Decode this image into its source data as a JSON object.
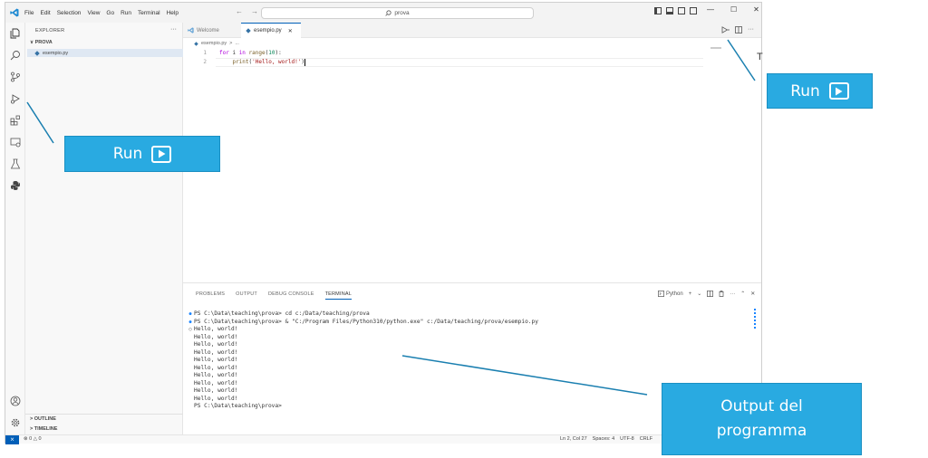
{
  "titlebar": {
    "menu": [
      "File",
      "Edit",
      "Selection",
      "View",
      "Go",
      "Run",
      "Terminal",
      "Help"
    ],
    "search_text": "prova",
    "back_glyph": "←",
    "forward_glyph": "→",
    "min_glyph": "—",
    "max_glyph": "☐",
    "close_glyph": "✕"
  },
  "sidebar": {
    "header": "EXPLORER",
    "folder": "PROVA",
    "file": "esempio.py",
    "outline": "OUTLINE",
    "timeline": "TIMELINE",
    "more_glyph": "···",
    "chevron_open": "∨",
    "chevron_closed": ">"
  },
  "editor": {
    "tabs": [
      {
        "label": "Welcome",
        "active": false
      },
      {
        "label": "esempio.py",
        "active": true
      }
    ],
    "tab_close_glyph": "✕",
    "breadcrumb": [
      "esempio.py",
      ">",
      "..."
    ],
    "lines": [
      {
        "num": "1",
        "kw": "for",
        "rest_a": " i ",
        "kw2": "in",
        "fn": " range",
        "num_lit": "10",
        "tail": "):"
      },
      {
        "num": "2",
        "indent": "    ",
        "fn": "print",
        "str": "'Hello, world!'",
        "tail": ")"
      }
    ]
  },
  "panel": {
    "tabs": [
      "PROBLEMS",
      "OUTPUT",
      "DEBUG CONSOLE",
      "TERMINAL"
    ],
    "active_tab": "TERMINAL",
    "terminal_profile": "Python",
    "terminal_lines": [
      {
        "dot": "●",
        "text": "PS C:\\Data\\teaching\\prova> cd c:/Data/teaching/prova"
      },
      {
        "dot": "●",
        "text": "PS C:\\Data\\teaching\\prova> & \"C:/Program Files/Python310/python.exe\" c:/Data/teaching/prova/esempio.py"
      },
      {
        "dot": "○",
        "text": "Hello, world!"
      },
      {
        "dot": "",
        "text": "Hello, world!"
      },
      {
        "dot": "",
        "text": "Hello, world!"
      },
      {
        "dot": "",
        "text": "Hello, world!"
      },
      {
        "dot": "",
        "text": "Hello, world!"
      },
      {
        "dot": "",
        "text": "Hello, world!"
      },
      {
        "dot": "",
        "text": "Hello, world!"
      },
      {
        "dot": "",
        "text": "Hello, world!"
      },
      {
        "dot": "",
        "text": "Hello, world!"
      },
      {
        "dot": "",
        "text": "Hello, world!"
      },
      {
        "dot": "",
        "text": "PS C:\\Data\\teaching\\prova>"
      }
    ]
  },
  "statusbar": {
    "remote": "⨯",
    "problems": "⊗ 0 △ 0",
    "position": "Ln 2, Col 27",
    "spaces": "Spaces: 4",
    "encoding": "UTF-8",
    "eol": "CRLF"
  },
  "callouts": {
    "run_top": "Run",
    "run_left": "Run",
    "output": [
      "Output del",
      "programma"
    ]
  },
  "stray_letter": "T",
  "colors": {
    "accent": "#005fb8",
    "callout": "#29aae1",
    "leader_line": "#1a7fb0"
  }
}
